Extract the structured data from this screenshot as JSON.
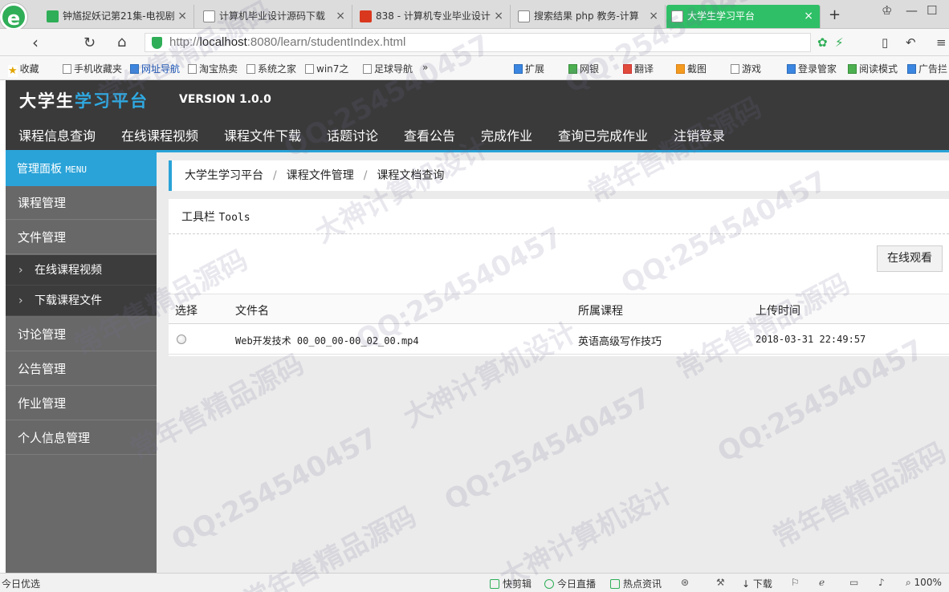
{
  "browser": {
    "logo": "e",
    "tabs": [
      {
        "title": "钟馗捉妖记第21集-电视剧",
        "active": false
      },
      {
        "title": "计算机毕业设计源码下载",
        "active": false
      },
      {
        "title": "838 - 计算机专业毕业设计",
        "active": false
      },
      {
        "title": "搜索结果 php 教务-计算",
        "active": false
      },
      {
        "title": "大学生学习平台",
        "active": true
      }
    ],
    "new_tab": "+",
    "url_prefix": "http://",
    "url_host": "localhost",
    "url_rest": ":8080/learn/studentIndex.html",
    "bookmarks_left": [
      "收藏",
      "手机收藏夹",
      "网址导航",
      "淘宝热卖",
      "系统之家",
      "win7之",
      "足球导航",
      "»"
    ],
    "bookmarks_right": [
      "扩展",
      "网银",
      "翻译",
      "截图",
      "游戏",
      "登录管家",
      "阅读模式",
      "广告拦"
    ]
  },
  "app": {
    "brand_white": "大学生",
    "brand_blue": "学习平台",
    "version": "VERSION 1.0.0",
    "topnav": [
      "课程信息查询",
      "在线课程视频",
      "课程文件下载",
      "话题讨论",
      "查看公告",
      "完成作业",
      "查询已完成作业",
      "注销登录"
    ]
  },
  "sidebar": {
    "header": "管理面板",
    "header_en": "MENU",
    "items_top": [
      "课程管理",
      "文件管理"
    ],
    "sub_items": [
      "在线课程视频",
      "下载课程文件"
    ],
    "items_bottom": [
      "讨论管理",
      "公告管理",
      "作业管理",
      "个人信息管理"
    ],
    "caret": "›"
  },
  "main": {
    "breadcrumb": [
      "大学生学习平台",
      "课程文件管理",
      "课程文档查询"
    ],
    "breadcrumb_sep": "/",
    "tools_title": "工具栏",
    "tools_en": "Tools",
    "watch_button": "在线观看",
    "table": {
      "headers": [
        "选择",
        "文件名",
        "所属课程",
        "上传时间"
      ],
      "rows": [
        {
          "filename": "Web开发技术 00_00_00-00_02_00.mp4",
          "course": "英语高级写作技巧",
          "uploaded": "2018-03-31 22:49:57"
        }
      ]
    }
  },
  "statusbar": {
    "left": "今日优选",
    "items": [
      "快剪辑",
      "今日直播",
      "热点资讯",
      "下载",
      "100%"
    ]
  },
  "watermark": {
    "qq": "QQ:254540457",
    "text1": "大神计算机设计",
    "text2": "常年售精品源码"
  }
}
